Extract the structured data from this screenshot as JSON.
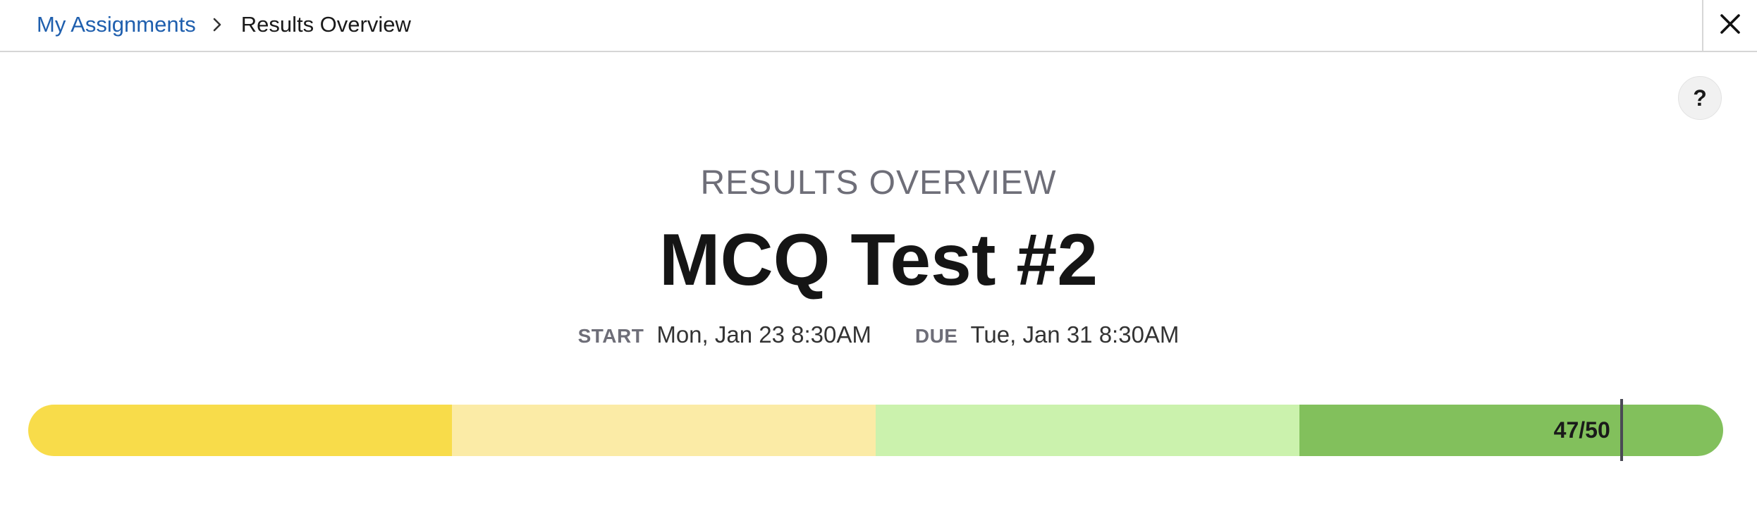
{
  "breadcrumb": {
    "parent": "My Assignments",
    "current": "Results Overview"
  },
  "header": {
    "section_label": "RESULTS OVERVIEW",
    "title": "MCQ Test #2",
    "help_label": "?"
  },
  "dates": {
    "start_label": "START",
    "start_value": "Mon, Jan 23 8:30AM",
    "due_label": "DUE",
    "due_value": "Tue, Jan 31 8:30AM"
  },
  "score": {
    "label": "47/50",
    "earned": 47,
    "total": 50,
    "bands": [
      {
        "color": "#f8dc4a"
      },
      {
        "color": "#fbeba6"
      },
      {
        "color": "#cbf2ad"
      },
      {
        "color": "#82c05c"
      }
    ]
  },
  "icons": {
    "breadcrumb_separator": "chevron-right-icon",
    "close": "close-icon",
    "help": "help-icon"
  }
}
